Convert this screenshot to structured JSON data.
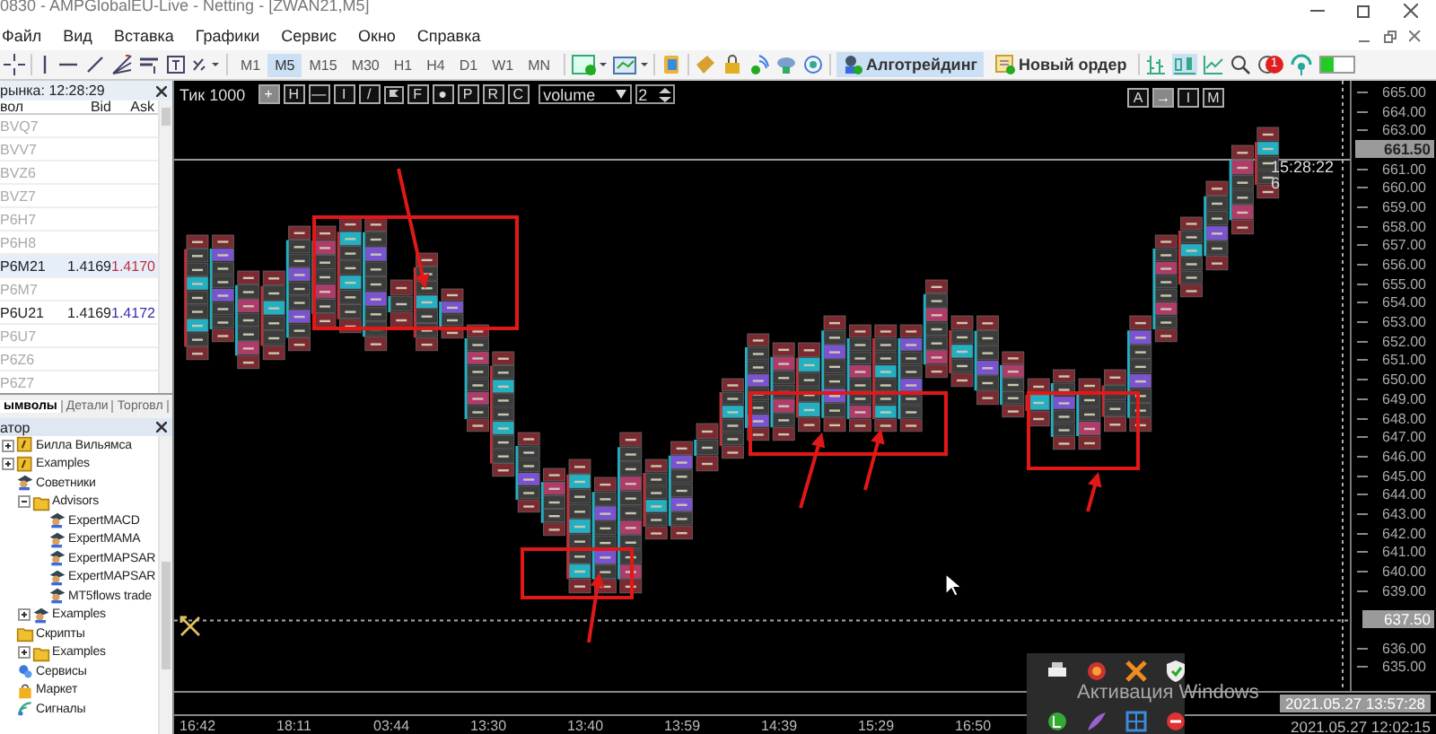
{
  "window": {
    "title": "0830 - AMPGlobalEU-Live - Netting - [ZWAN21,M5]"
  },
  "menu": [
    "Файл",
    "Вид",
    "Вставка",
    "Графики",
    "Сервис",
    "Окно",
    "Справка"
  ],
  "toolbar": {
    "timeframes": [
      {
        "label": "M1",
        "selected": false
      },
      {
        "label": "M5",
        "selected": true
      },
      {
        "label": "M15",
        "selected": false
      },
      {
        "label": "M30",
        "selected": false
      },
      {
        "label": "H1",
        "selected": false
      },
      {
        "label": "H4",
        "selected": false
      },
      {
        "label": "D1",
        "selected": false
      },
      {
        "label": "W1",
        "selected": false
      },
      {
        "label": "MN",
        "selected": false
      }
    ],
    "buttons": [
      {
        "label": "Алготрейдинг",
        "active": true
      },
      {
        "label": "Новый ордер",
        "active": false
      }
    ],
    "alert_badge": "1"
  },
  "market_watch": {
    "title": "рынка: 12:28:29",
    "columns": [
      "вол",
      "Bid",
      "Ask"
    ],
    "rows": [
      {
        "symbol": "BVQ7",
        "greyed": true,
        "selected": false
      },
      {
        "symbol": "BVV7",
        "greyed": true,
        "selected": false
      },
      {
        "symbol": "BVZ6",
        "greyed": true,
        "selected": false
      },
      {
        "symbol": "BVZ7",
        "greyed": true,
        "selected": false
      },
      {
        "symbol": "P6H7",
        "greyed": true,
        "selected": false
      },
      {
        "symbol": "P6H8",
        "greyed": true,
        "selected": false
      },
      {
        "symbol": "P6M21",
        "bid": "1.4169",
        "ask": "1.4170",
        "color": "#c0303a",
        "greyed": false,
        "selected": true
      },
      {
        "symbol": "P6M7",
        "greyed": true,
        "selected": false
      },
      {
        "symbol": "P6U21",
        "bid": "1.4169",
        "ask": "1.4172",
        "color": "#3030b0",
        "greyed": false,
        "selected": false
      },
      {
        "symbol": "P6U7",
        "greyed": true,
        "selected": false
      },
      {
        "symbol": "P6Z6",
        "greyed": true,
        "selected": false
      },
      {
        "symbol": "P6Z7",
        "greyed": true,
        "selected": false
      }
    ],
    "tabs": [
      {
        "label": "ымволы",
        "selected": true
      },
      {
        "label": "Детали",
        "selected": false
      },
      {
        "label": "Торговл",
        "selected": false
      }
    ]
  },
  "navigator": {
    "title": "атор",
    "tree": [
      {
        "label": "Билла Вильямса",
        "kind": "indicator",
        "expanded": false
      },
      {
        "label": "Examples",
        "kind": "indicator",
        "expanded": false
      },
      {
        "label": "Советники",
        "kind": "expert",
        "children": [
          {
            "label": "Advisors",
            "kind": "folder",
            "expanded": true,
            "children": [
              {
                "label": "ExpertMACD",
                "kind": "expert"
              },
              {
                "label": "ExpertMAMA",
                "kind": "expert"
              },
              {
                "label": "ExpertMAPSAR",
                "kind": "expert"
              },
              {
                "label": "ExpertMAPSAR",
                "kind": "expert"
              },
              {
                "label": "MT5flows trade",
                "kind": "expert"
              }
            ]
          },
          {
            "label": "Examples",
            "kind": "expert",
            "expanded": false
          }
        ]
      },
      {
        "label": "Скрипты",
        "kind": "folder",
        "children": [
          {
            "label": "Examples",
            "kind": "folder",
            "expanded": false
          }
        ]
      },
      {
        "label": "Сервисы",
        "kind": "services"
      },
      {
        "label": "Маркет",
        "kind": "market"
      },
      {
        "label": "Сигналы",
        "kind": "signals"
      }
    ]
  },
  "chart": {
    "bar_type": "Тик 1000",
    "tools": [
      {
        "kind": "text",
        "label": "+",
        "on": true
      },
      {
        "kind": "text",
        "label": "H",
        "on": false
      },
      {
        "kind": "text",
        "label": "—",
        "on": false
      },
      {
        "kind": "text",
        "label": "I",
        "on": false
      },
      {
        "kind": "text",
        "label": "/",
        "on": false
      },
      {
        "kind": "flag",
        "on": false
      },
      {
        "kind": "text",
        "label": "F",
        "on": false
      },
      {
        "kind": "text",
        "label": "●",
        "on": false
      },
      {
        "kind": "text",
        "label": "P",
        "on": false
      },
      {
        "kind": "text",
        "label": "R",
        "on": false
      },
      {
        "kind": "text",
        "label": "C",
        "on": false
      }
    ],
    "mode": "volume",
    "step": "2",
    "corner_buttons": [
      {
        "label": "A",
        "on": false
      },
      {
        "label": "→",
        "on": true
      },
      {
        "label": "I",
        "on": false
      },
      {
        "label": "M",
        "on": false
      }
    ],
    "bar_time": "15:28:22",
    "countdown": "6",
    "price_labels_upper": [
      "665.00",
      "664.00",
      "663.00"
    ],
    "price_labels_middle": [
      "661.00",
      "660.00",
      "659.00",
      "658.00",
      "657.00",
      "656.00",
      "655.00",
      "654.00",
      "653.00",
      "652.00",
      "651.00",
      "650.00",
      "649.00",
      "648.00",
      "647.00",
      "646.00",
      "645.00",
      "644.00",
      "643.00",
      "642.00",
      "641.00",
      "640.00",
      "639.00"
    ],
    "price_labels_lower": [
      "636.00",
      "635.00"
    ],
    "current_price": "661.50",
    "crosshair_price": "637.50",
    "time_labels": [
      "16:42",
      "18:11",
      "03:44",
      "13:30",
      "13:40",
      "13:59",
      "14:39",
      "15:29",
      "16:50"
    ],
    "crosshair_time": "2021.05.27 13:57:28",
    "last_time": "2021.05.27 12:02:15"
  },
  "notice": {
    "text": "Активация Windows"
  }
}
